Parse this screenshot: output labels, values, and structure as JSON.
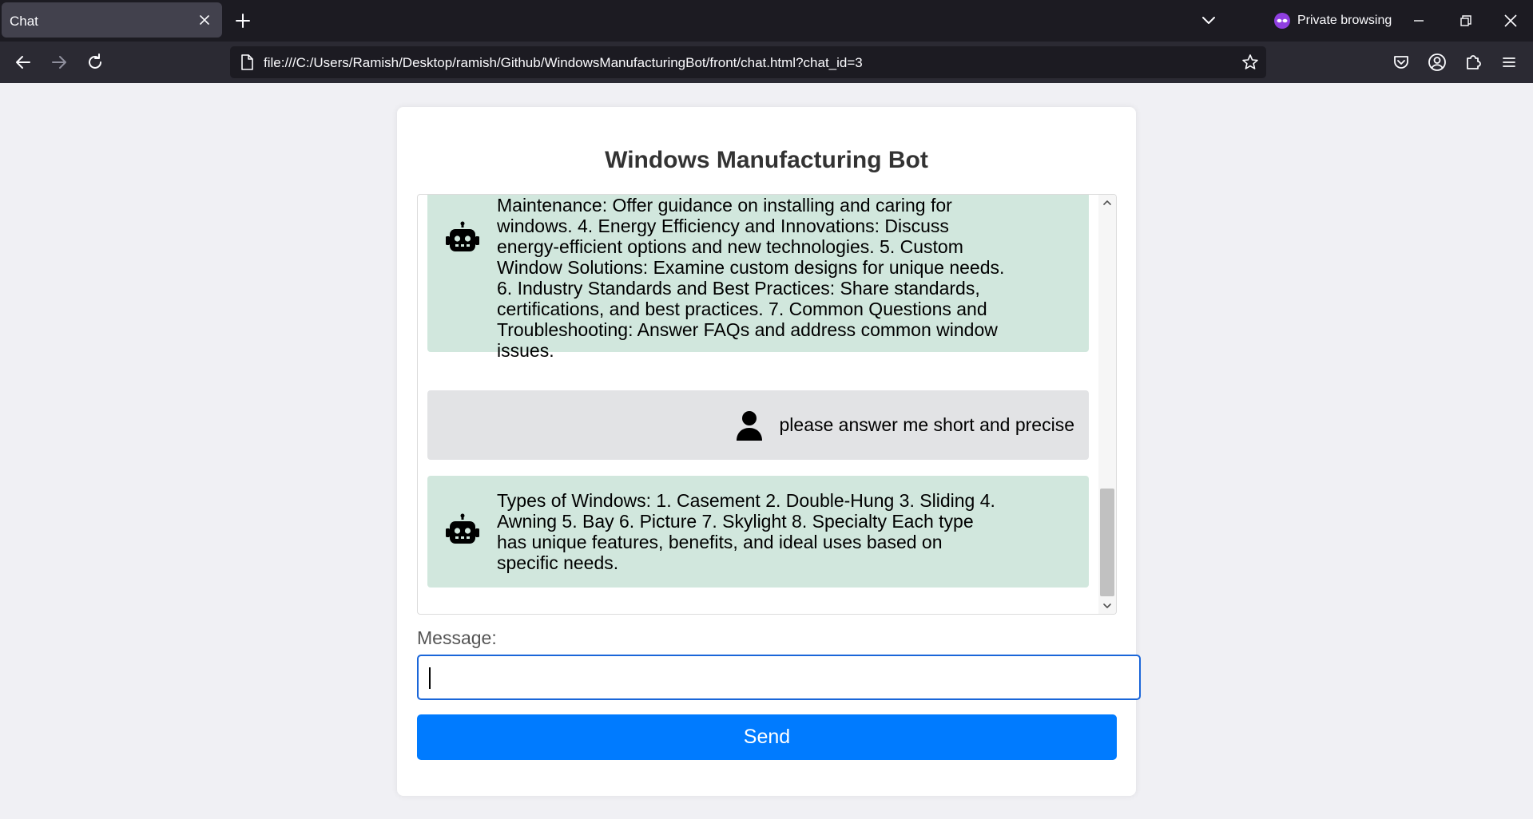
{
  "browser": {
    "tab_title": "Chat",
    "private_label": "Private browsing",
    "url": "file:///C:/Users/Ramish/Desktop/ramish/Github/WindowsManufacturingBot/front/chat.html?chat_id=3"
  },
  "page": {
    "title": "Windows Manufacturing Bot",
    "message_label": "Message:",
    "input_value": "",
    "send_label": "Send"
  },
  "messages": [
    {
      "role": "bot",
      "icon": "robot-icon",
      "text": "Maintenance: Offer guidance on installing and caring for windows. 4. Energy Efficiency and Innovations: Discuss energy-efficient options and new technologies. 5. Custom Window Solutions: Examine custom designs for unique needs. 6. Industry Standards and Best Practices: Share standards, certifications, and best practices. 7. Common Questions and Troubleshooting: Answer FAQs and address common window issues."
    },
    {
      "role": "user",
      "icon": "user-icon",
      "text": "please answer me short and precise"
    },
    {
      "role": "bot",
      "icon": "robot-icon",
      "text": "Types of Windows: 1. Casement 2. Double-Hung 3. Sliding 4. Awning 5. Bay 6. Picture 7. Skylight 8. Specialty Each type has unique features, benefits, and ideal uses based on specific needs."
    }
  ],
  "colors": {
    "bot_bubble": "#d1e7dd",
    "user_bubble": "#e2e3e5",
    "send_button": "#007bff",
    "input_focus_border": "#1a66d9"
  }
}
